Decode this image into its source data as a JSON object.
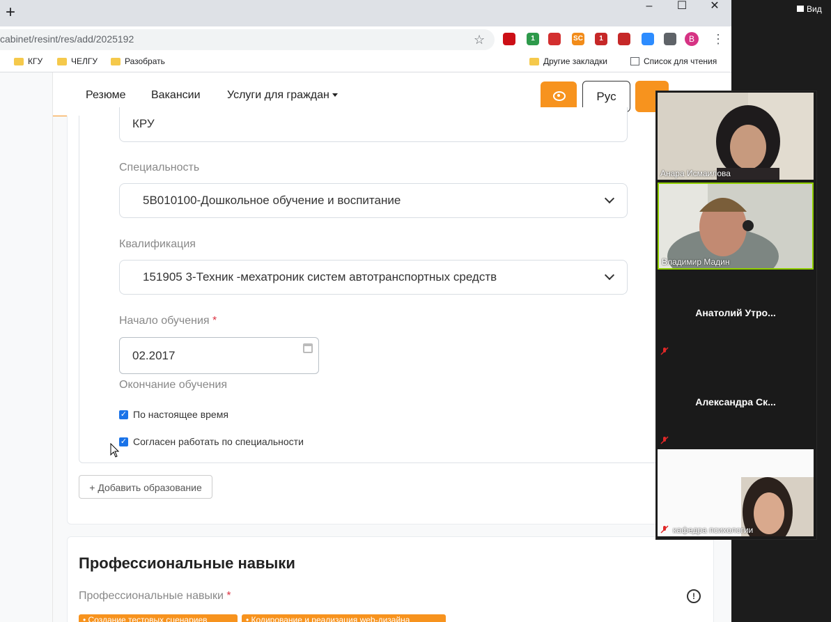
{
  "browser": {
    "newtab_glyph": "+",
    "window_controls": [
      "–",
      "☐",
      "✕"
    ],
    "url": "cabinet/resint/res/add/2025192",
    "profile_initial": "B",
    "bookmarks": [
      "КГУ",
      "ЧЕЛГУ",
      "Разобрать"
    ],
    "bookmarks_right": [
      "Другие закладки",
      "Список для чтения"
    ],
    "extensions": [
      {
        "name": "opera-icon",
        "color": "#cc0f16",
        "label": ""
      },
      {
        "name": "ext-badge-icon",
        "color": "#2e9a4b",
        "label": "1"
      },
      {
        "name": "sync-icon",
        "color": "#d32f2f",
        "label": ""
      },
      {
        "name": "sc-icon",
        "color": "#f28c1a",
        "label": "SC"
      },
      {
        "name": "mail-icon",
        "color": "#c62828",
        "label": "1"
      },
      {
        "name": "pdf-icon",
        "color": "#c62828",
        "label": ""
      },
      {
        "name": "zoom-icon",
        "color": "#2d8cff",
        "label": ""
      },
      {
        "name": "puzzle-icon",
        "color": "#5f6368",
        "label": ""
      }
    ]
  },
  "nav": {
    "links": [
      "Резюме",
      "Вакансии",
      "Услуги для граждан"
    ],
    "lang": "Рус"
  },
  "form": {
    "institution_value": "КРУ",
    "specialty_label": "Специальность",
    "specialty_value": "5B010100-Дошкольное обучение и воспитание",
    "qualification_label": "Квалификация",
    "qualification_value": "151905 3-Техник -мехатроник систем автотранспортных средств",
    "start_label": "Начало обучения",
    "start_value": "02.2017",
    "end_label": "Окончание обучения",
    "checkbox_present": "По настоящее время",
    "checkbox_agree": "Согласен работать по специальности",
    "add_education": "+ Добавить образование"
  },
  "skills": {
    "heading": "Профессиональные навыки",
    "label": "Профессиональные навыки",
    "tags": [
      "• Создание тестовых сценариев",
      "• Кодирование и реализация web-дизайна"
    ]
  },
  "zoom": {
    "view_label": "Вид",
    "participants": [
      {
        "name": "Анара Исмаилова",
        "video": true
      },
      {
        "name": "Владимир Мадин",
        "video": true
      },
      {
        "name": "Анатолий  Утро...",
        "video": false
      },
      {
        "name": "Александра  Ск...",
        "video": false
      },
      {
        "name": "кафедра психологии",
        "video": true
      }
    ]
  }
}
